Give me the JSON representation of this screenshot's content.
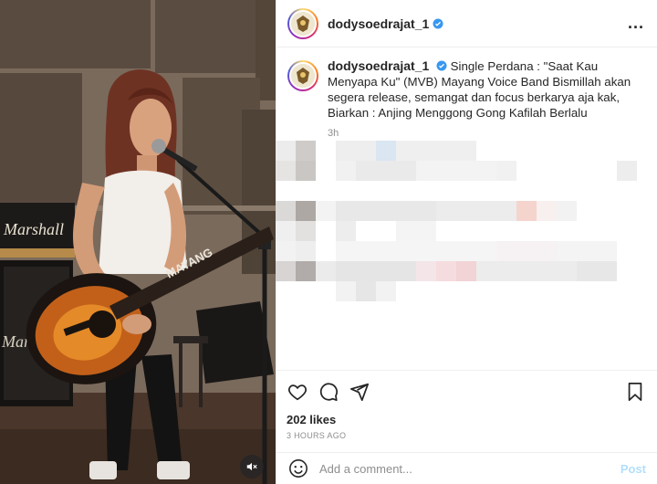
{
  "post": {
    "username": "dodysoedrajat_1",
    "more_label": "...",
    "caption": "Single Perdana : \"Saat Kau Menyapa Ku\" (MVB) Mayang Voice Band Bismillah akan segera release, semangat dan focus berkarya aja kak, Biarkan : Anjing Menggong Gong Kafilah Berlalu",
    "caption_time": "3h",
    "likes": "202 likes",
    "time_ago": "3 hours ago"
  },
  "media": {
    "amp_brand": "Marshall",
    "cab_brand": "Mars",
    "guitar_text": "MAYANG"
  },
  "comment": {
    "placeholder": "Add a comment...",
    "post_label": "Post"
  },
  "icons": {
    "verified": "verified-badge-icon",
    "like": "heart-icon",
    "comment": "comment-icon",
    "share": "share-icon",
    "save": "bookmark-icon",
    "emoji": "emoji-icon",
    "mute": "muted-speaker-icon"
  },
  "colors": {
    "verified_blue": "#3897f0",
    "post_button": "#b2dffc",
    "muted_text": "#8e8e8e"
  }
}
